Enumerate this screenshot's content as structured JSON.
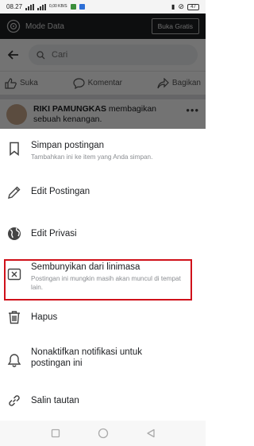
{
  "status": {
    "time": "08.27",
    "net_speed": "0,00 KB/S",
    "battery": "47"
  },
  "topbar": {
    "mode_label": "Mode Data",
    "free_button": "Buka Gratis"
  },
  "search": {
    "placeholder": "Cari"
  },
  "actions": {
    "like": "Suka",
    "comment": "Komentar",
    "share": "Bagikan"
  },
  "post": {
    "author": "RIKI PAMUNGKAS",
    "text": " membagikan sebuah kenangan."
  },
  "menu": [
    {
      "title": "Simpan postingan",
      "sub": "Tambahkan ini ke item yang Anda simpan.",
      "icon": "bookmark-icon"
    },
    {
      "title": "Edit Postingan",
      "sub": "",
      "icon": "pencil-icon"
    },
    {
      "title": "Edit Privasi",
      "sub": "",
      "icon": "globe-icon"
    },
    {
      "title": "Sembunyikan dari linimasa",
      "sub": "Postingan ini mungkin masih akan muncul di tempat lain.",
      "icon": "hide-x-icon"
    },
    {
      "title": "Hapus",
      "sub": "",
      "icon": "trash-icon"
    },
    {
      "title": "Nonaktifkan notifikasi untuk postingan ini",
      "sub": "",
      "icon": "bell-icon"
    },
    {
      "title": "Salin tautan",
      "sub": "",
      "icon": "link-icon"
    }
  ],
  "colors": {
    "highlight": "#d0111a",
    "topbar": "#1d1f22"
  }
}
